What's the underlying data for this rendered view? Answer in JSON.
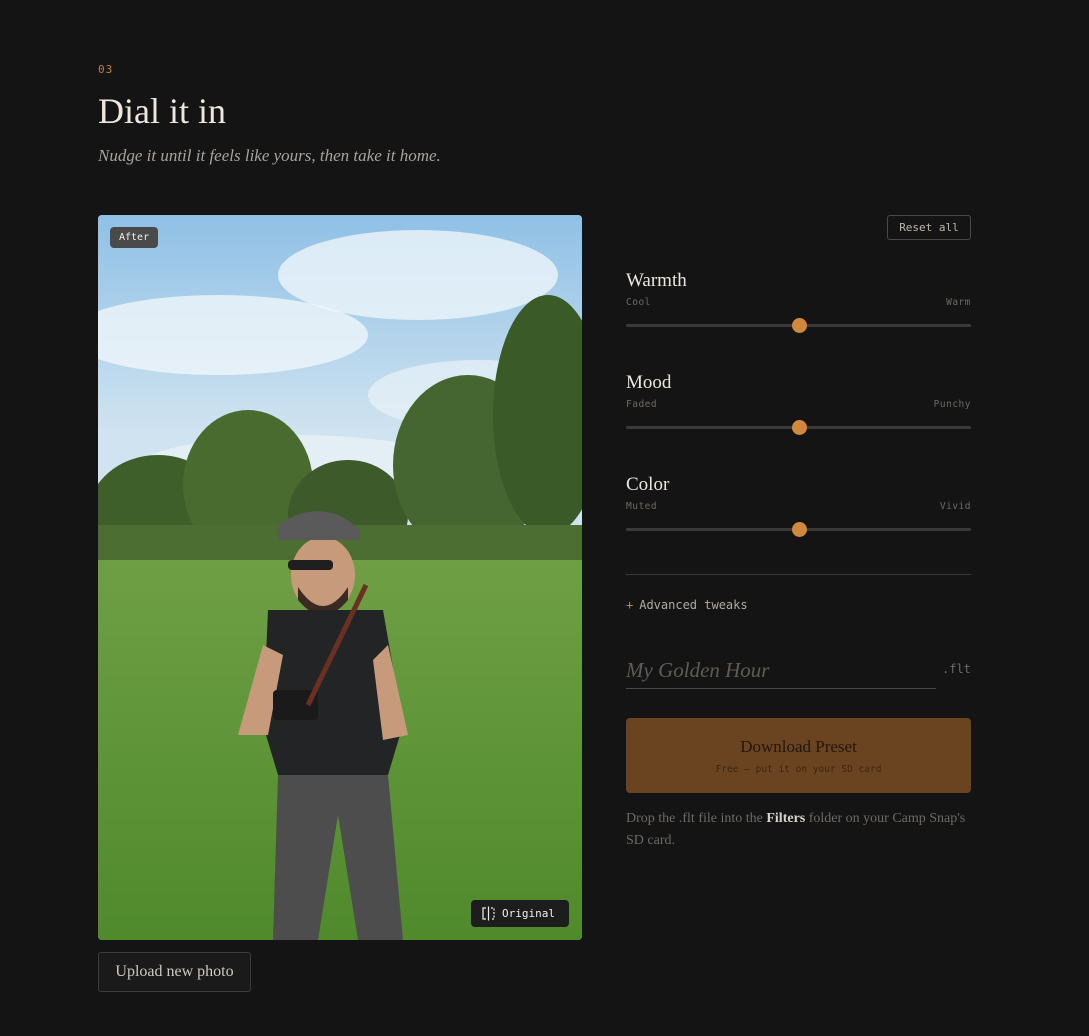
{
  "header": {
    "step": "03",
    "title": "Dial it in",
    "subtitle": "Nudge it until it feels like yours, then take it home."
  },
  "preview": {
    "badge": "After",
    "original_label": "Original",
    "upload_label": "Upload new photo"
  },
  "controls": {
    "reset_label": "Reset all",
    "sliders": [
      {
        "label": "Warmth",
        "min_label": "Cool",
        "max_label": "Warm",
        "value": 0.5
      },
      {
        "label": "Mood",
        "min_label": "Faded",
        "max_label": "Punchy",
        "value": 0.5
      },
      {
        "label": "Color",
        "min_label": "Muted",
        "max_label": "Vivid",
        "value": 0.5
      }
    ],
    "advanced_label": "Advanced tweaks",
    "name_placeholder": "My Golden Hour",
    "name_value": "",
    "extension": ".flt",
    "download_label": "Download Preset",
    "download_sub": "Free — put it on your SD card",
    "hint_pre": "Drop the .flt file into the",
    "hint_bold": "Filters",
    "hint_post": "folder on your Camp Snap's SD card."
  },
  "colors": {
    "accent": "#d0893c",
    "background": "#141414",
    "button": "#6a4420"
  }
}
